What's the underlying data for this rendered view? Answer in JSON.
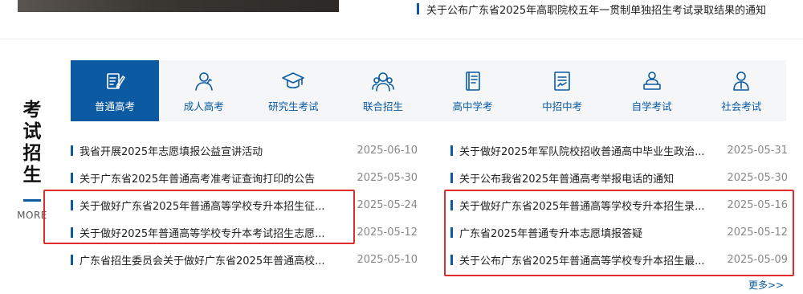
{
  "top_news": {
    "title": "关于公布广东省2025年高职院校五年一贯制单独招生考试录取结果的通知"
  },
  "side": {
    "title_chars": [
      "考",
      "试",
      "招",
      "生"
    ],
    "more_label": "MORE"
  },
  "tabs": [
    {
      "label": "普通高考",
      "icon": "edit-document-icon",
      "active": true
    },
    {
      "label": "成人高考",
      "icon": "adult-learner-icon",
      "active": false
    },
    {
      "label": "研究生考试",
      "icon": "graduation-cap-icon",
      "active": false
    },
    {
      "label": "联合招生",
      "icon": "group-icon",
      "active": false
    },
    {
      "label": "高中学考",
      "icon": "textbook-icon",
      "active": false
    },
    {
      "label": "中招中考",
      "icon": "exam-paper-icon",
      "active": false
    },
    {
      "label": "自学考试",
      "icon": "self-study-icon",
      "active": false
    },
    {
      "label": "社会考试",
      "icon": "person-badge-icon",
      "active": false
    }
  ],
  "news_left": [
    {
      "title": "我省开展2025年志愿填报公益宣讲活动",
      "date": "2025-06-10"
    },
    {
      "title": "关于广东省2025年普通高考准考证查询打印的公告",
      "date": "2025-05-30"
    },
    {
      "title": "关于做好广东省2025年普通高等学校专升本招生征...",
      "date": "2025-05-24"
    },
    {
      "title": "关于做好2025年普通高等学校专升本考试招生志愿...",
      "date": "2025-05-12"
    },
    {
      "title": "广东省招生委员会关于做好广东省2025年普通高校...",
      "date": "2025-05-10"
    }
  ],
  "news_right": [
    {
      "title": "关于做好2025年军队院校招收普通高中毕业生政治...",
      "date": "2025-05-31"
    },
    {
      "title": "关于公布我省2025年普通高考举报电话的通知",
      "date": "2025-05-30"
    },
    {
      "title": "关于做好广东省2025年普通高等学校专升本招生录...",
      "date": "2025-05-16"
    },
    {
      "title": "广东省2025年普通专升本志愿填报答疑",
      "date": "2025-05-12"
    },
    {
      "title": "关于公布广东省2025年普通高等学校专升本招生最...",
      "date": "2025-05-09"
    }
  ],
  "more_link": "更多>>",
  "colors": {
    "accent": "#0b5aa2",
    "highlight": "#e02b2b"
  }
}
